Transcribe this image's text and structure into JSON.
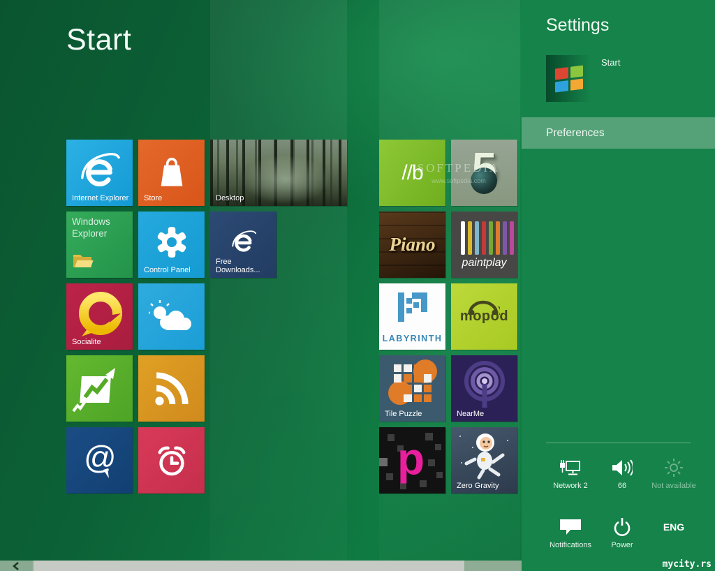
{
  "main": {
    "title": "Start",
    "watermarks": {
      "softpedia": "SOFTPEDIA",
      "softpedia_url": "www.softpedia.com",
      "site": "mycity.rs"
    }
  },
  "tiles": {
    "internet_explorer": {
      "label": "Internet Explorer"
    },
    "store": {
      "label": "Store"
    },
    "desktop": {
      "label": "Desktop"
    },
    "windows_explorer": {
      "label": "Windows Explorer"
    },
    "control_panel": {
      "label": "Control Panel"
    },
    "free_downloads": {
      "label": "Free Downloads..."
    },
    "socialite": {
      "label": "Socialite"
    },
    "b_board": {
      "logo_text": "//b"
    },
    "five": {
      "logo_text": "5"
    },
    "piano": {
      "logo_text": "Piano"
    },
    "paintplay": {
      "logo_text": "paintplay"
    },
    "labyrinth": {
      "logo_text": "LABYRINTH"
    },
    "mopod": {
      "logo_text": "mopod"
    },
    "tile_puzzle": {
      "label": "Tile Puzzle"
    },
    "nearme": {
      "label": "NearMe"
    },
    "p_app": {
      "logo_text": "p"
    },
    "zero_gravity": {
      "label": "Zero Gravity"
    }
  },
  "settings": {
    "title": "Settings",
    "start_label": "Start",
    "preferences_label": "Preferences",
    "quick": {
      "network_label": "Network 2",
      "volume_label": "66",
      "brightness_label": "Not available",
      "notifications_label": "Notifications",
      "power_label": "Power",
      "language_label": "ENG"
    }
  },
  "colors": {
    "panel_green": "#15834a",
    "preferences_highlight": "#55a278",
    "background_green_dark": "#0a5530",
    "background_green_light": "#0f7a42",
    "tile_cyan": "#1b9ed6",
    "tile_orange": "#d9551a",
    "tile_crimson": "#a91d3f",
    "tile_green": "#4da426",
    "tile_navy": "#123f72",
    "socialite_yellow": "#f2cb1d",
    "p_pink": "#ea1f9e"
  },
  "paint_stripe_colors": [
    "#ffffff",
    "#d9b92c",
    "#7fb6c9",
    "#c23b3b",
    "#76a836",
    "#de7a2b",
    "#7e57a8",
    "#b8499b"
  ]
}
